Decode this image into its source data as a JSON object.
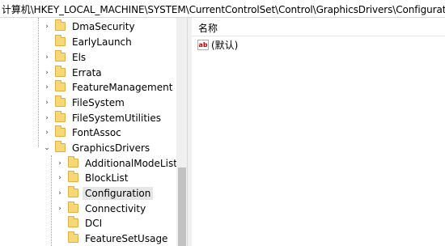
{
  "address_bar": {
    "path": "计算机\\HKEY_LOCAL_MACHINE\\SYSTEM\\CurrentControlSet\\Control\\GraphicsDrivers\\Configuration"
  },
  "tree": {
    "items": [
      {
        "label": "DmaSecurity",
        "expander": "›"
      },
      {
        "label": "EarlyLaunch",
        "expander": ""
      },
      {
        "label": "Els",
        "expander": "›"
      },
      {
        "label": "Errata",
        "expander": "›"
      },
      {
        "label": "FeatureManagement",
        "expander": "›"
      },
      {
        "label": "FileSystem",
        "expander": "›"
      },
      {
        "label": "FileSystemUtilities",
        "expander": "›"
      },
      {
        "label": "FontAssoc",
        "expander": "›"
      },
      {
        "label": "GraphicsDrivers",
        "expander": "⌄"
      },
      {
        "label": "AdditionalModeLists",
        "expander": "›"
      },
      {
        "label": "BlockList",
        "expander": "›"
      },
      {
        "label": "Configuration",
        "expander": "›",
        "selected": true
      },
      {
        "label": "Connectivity",
        "expander": "›"
      },
      {
        "label": "DCI",
        "expander": ""
      },
      {
        "label": "FeatureSetUsage",
        "expander": ""
      }
    ]
  },
  "values_pane": {
    "column_name": "名称",
    "rows": [
      {
        "icon": "ab",
        "name": "(默认)"
      }
    ]
  }
}
